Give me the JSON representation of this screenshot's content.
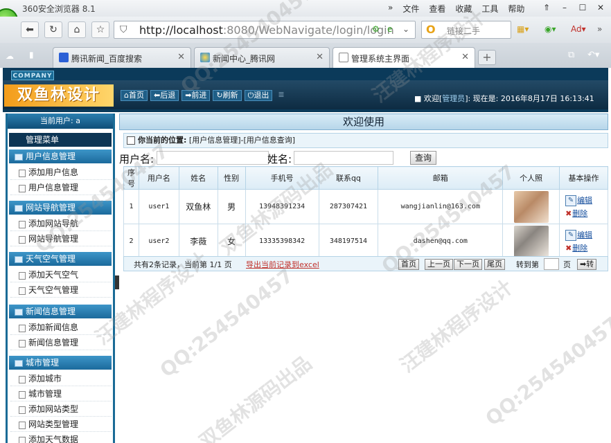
{
  "browser": {
    "title": "360安全浏览器 8.1",
    "menus": [
      "»",
      "文件",
      "查看",
      "收藏",
      "工具",
      "帮助"
    ],
    "url_host": "http://localhost",
    "url_rest": ":8080/WebNavigate/login/login",
    "search_placeholder": "链接二手",
    "tabs": [
      {
        "label": "腾讯新闻_百度搜索",
        "active": false
      },
      {
        "label": "新闻中心_腾讯网",
        "active": false
      },
      {
        "label": "管理系统主界面",
        "active": true
      }
    ]
  },
  "app": {
    "company": "COMPANY",
    "brand": "双鱼林设计",
    "header_buttons": [
      "首页",
      "后退",
      "前进",
      "刷新",
      "退出"
    ],
    "welcome_prefix": "欢迎[",
    "welcome_role": "管理员",
    "welcome_mid": "]: 现在是: 2016年8月17日  16:13:41"
  },
  "sidebar": {
    "current_user": "当前用户: a",
    "menu_title": "管理菜单",
    "groups": [
      {
        "title": "用户信息管理",
        "items": [
          "添加用户信息",
          "用户信息管理"
        ]
      },
      {
        "title": "网站导航管理",
        "items": [
          "添加网站导航",
          "网站导航管理"
        ]
      },
      {
        "title": "天气空气管理",
        "items": [
          "添加天气空气",
          "天气空气管理"
        ]
      },
      {
        "title": "新闻信息管理",
        "items": [
          "添加新闻信息",
          "新闻信息管理"
        ]
      },
      {
        "title": "城市管理",
        "items": [
          "添加城市",
          "城市管理",
          "添加网站类型",
          "网站类型管理",
          "添加天气数据"
        ]
      }
    ]
  },
  "main": {
    "header": "欢迎使用",
    "crumb_label": "你当前的位置:",
    "crumb_path": "[用户信息管理]-[用户信息查询]",
    "filter": {
      "username_label": "用户名:",
      "name_label": "姓名:",
      "query_button": "查询"
    },
    "columns": [
      "序号",
      "用户名",
      "姓名",
      "性别",
      "手机号",
      "联系qq",
      "邮箱",
      "个人照",
      "基本操作"
    ],
    "rows": [
      {
        "no": "1",
        "user": "user1",
        "name": "双鱼林",
        "sex": "男",
        "phone": "13948391234",
        "qq": "287307421",
        "email": "wangjianlin@163.com",
        "edit": "编辑",
        "del": "删除"
      },
      {
        "no": "2",
        "user": "user2",
        "name": "李薇",
        "sex": "女",
        "phone": "13335398342",
        "qq": "348197514",
        "email": "dashen@qq.com",
        "edit": "编辑",
        "del": "删除"
      }
    ],
    "pager": {
      "info": "共有2条记录，当前第 1/1 页",
      "export": "导出当前记录到excel",
      "buttons": [
        "首页",
        "上一页",
        "下一页",
        "尾页"
      ],
      "goto": "转到第",
      "page_unit": "页",
      "go": "➡转"
    }
  },
  "watermarks": [
    "QQ:254540457",
    "双鱼林源码出品",
    "汪建林程序设计"
  ]
}
